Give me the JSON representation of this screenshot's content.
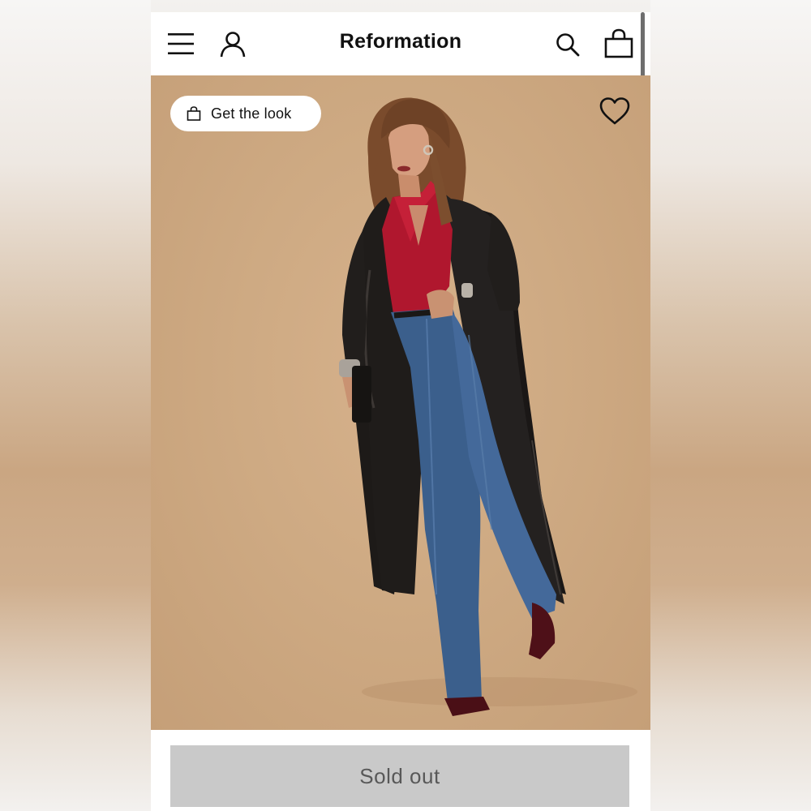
{
  "header": {
    "brand": "Reformation",
    "icons": [
      "menu-icon",
      "account-icon",
      "search-icon",
      "bag-icon"
    ]
  },
  "hero": {
    "get_the_look_label": "Get the look",
    "image_alt": "Model wearing long black leather trench coat, red blouse and straight-leg blue jeans",
    "wishlist_icon": "heart-icon"
  },
  "cta": {
    "label": "Sold out",
    "state": "disabled"
  },
  "colors": {
    "hero_background": "#ceaa83",
    "cta_background": "#c9c9c9",
    "cta_text": "#585858",
    "brand_text": "#111111"
  }
}
